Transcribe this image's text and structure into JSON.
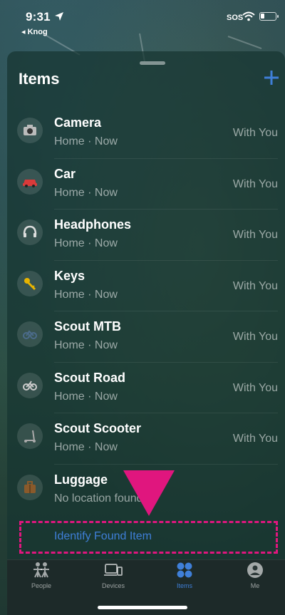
{
  "status_bar": {
    "time": "9:31",
    "back_app": "◂ Knog",
    "carrier": "SOS",
    "battery_level": 0.25
  },
  "header": {
    "title": "Items",
    "add_label": "+"
  },
  "items": [
    {
      "name": "Camera",
      "subtitle": "Home · Now",
      "status": "With You",
      "icon": "camera-icon"
    },
    {
      "name": "Car",
      "subtitle": "Home · Now",
      "status": "With You",
      "icon": "car-icon"
    },
    {
      "name": "Headphones",
      "subtitle": "Home · Now",
      "status": "With You",
      "icon": "headphones-icon"
    },
    {
      "name": "Keys",
      "subtitle": "Home · Now",
      "status": "With You",
      "icon": "key-icon"
    },
    {
      "name": "Scout MTB",
      "subtitle": "Home · Now",
      "status": "With You",
      "icon": "mountain-bike-icon"
    },
    {
      "name": "Scout Road",
      "subtitle": "Home · Now",
      "status": "With You",
      "icon": "road-bike-icon"
    },
    {
      "name": "Scout Scooter",
      "subtitle": "Home · Now",
      "status": "With You",
      "icon": "scooter-icon"
    },
    {
      "name": "Luggage",
      "subtitle": "No location found",
      "status": "",
      "icon": "luggage-icon"
    }
  ],
  "identify": {
    "label": "Identify Found Item"
  },
  "tabs": [
    {
      "label": "People",
      "icon": "people-icon"
    },
    {
      "label": "Devices",
      "icon": "devices-icon"
    },
    {
      "label": "Items",
      "icon": "items-icon"
    },
    {
      "label": "Me",
      "icon": "me-icon"
    }
  ],
  "colors": {
    "accent": "#3f7fd8",
    "highlight": "#e0167e"
  }
}
